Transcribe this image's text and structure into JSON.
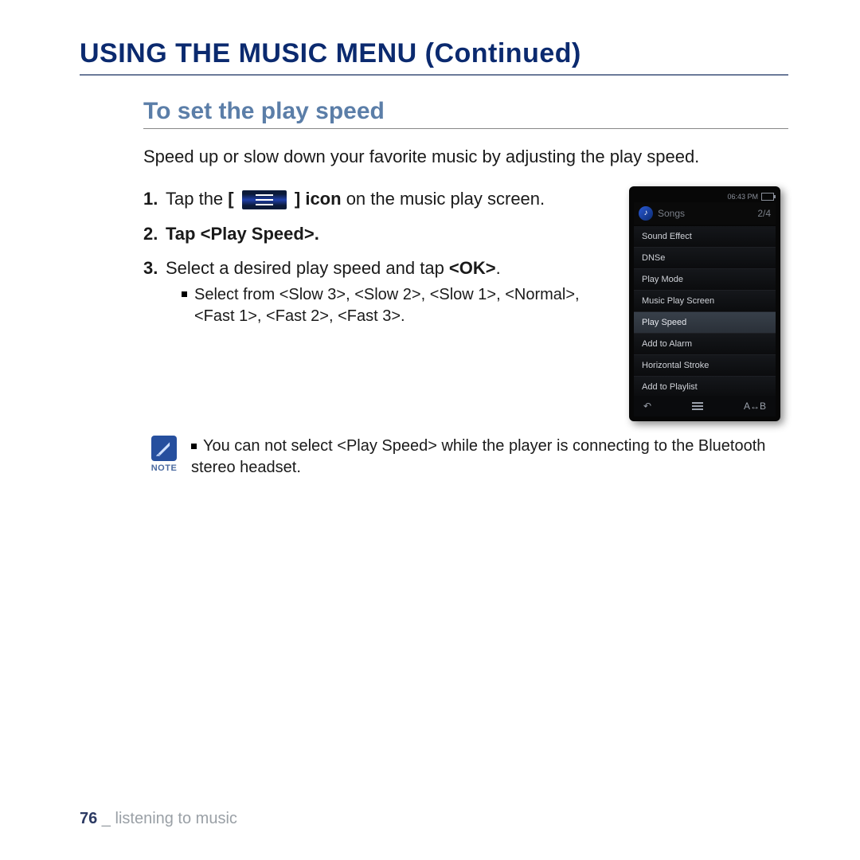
{
  "heading": "USING THE MUSIC MENU (Continued)",
  "subheading": "To set the play speed",
  "intro": "Speed up or slow down your favorite music by adjusting the play speed.",
  "steps": {
    "s1a": "Tap the",
    "s1b": "[",
    "s1c": "]",
    "s1d": "icon",
    "s1e": "on the music play screen.",
    "s2a": "Tap ",
    "s2b": "<Play Speed>",
    "s2c": ".",
    "s3a": "Select a desired play speed and tap ",
    "s3b": "<OK>",
    "s3c": ".",
    "s3_sub": "Select from <Slow 3>, <Slow 2>, <Slow 1>, <Normal>, <Fast 1>, <Fast 2>, <Fast 3>."
  },
  "note": {
    "label": "NOTE",
    "text": "You can not select <Play Speed> while the player is connecting to the Bluetooth stereo headset."
  },
  "device": {
    "time": "06:43 PM",
    "title": "Songs",
    "count": "2/4",
    "menu": [
      "Sound Effect",
      "DNSe",
      "Play Mode",
      "Music Play Screen",
      "Play Speed",
      "Add to Alarm",
      "Horizontal Stroke",
      "Add to Playlist"
    ],
    "selected": "Play Speed",
    "bottom_right": "A↔B"
  },
  "footer": {
    "page": "76",
    "sep": " _ ",
    "section": "listening to music"
  }
}
